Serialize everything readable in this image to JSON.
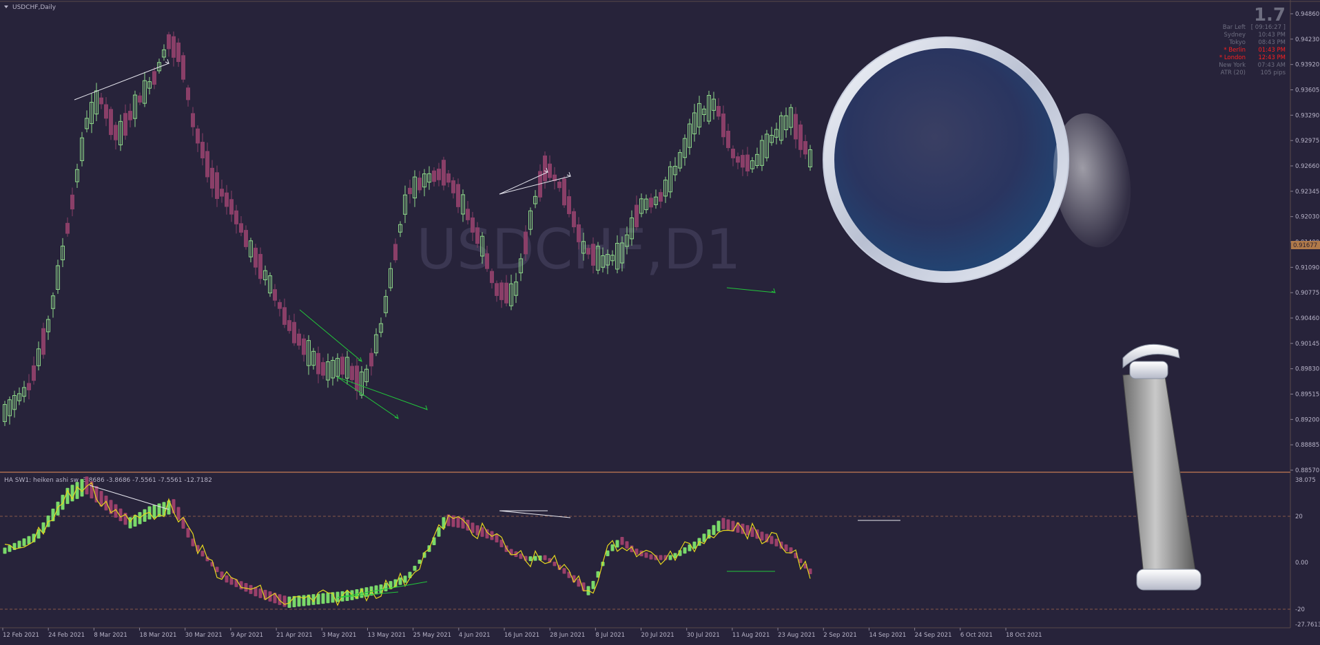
{
  "window": {
    "symbol_title": "USDCHF,Daily",
    "watermark": "USDCHF,D1"
  },
  "info_panel": {
    "big_value": "1.7",
    "rows": [
      {
        "label": "Bar Left",
        "value": "[ 09:16:27 ]",
        "highlight": false
      },
      {
        "label": "Sydney",
        "value": "10:43 PM",
        "highlight": false
      },
      {
        "label": "Tokyo",
        "value": "08:43 PM",
        "highlight": false
      },
      {
        "label": "* Berlin",
        "value": "01:43 PM",
        "highlight": true
      },
      {
        "label": "* London",
        "value": "12:43 PM",
        "highlight": true
      },
      {
        "label": "New York",
        "value": "07:43 AM",
        "highlight": false
      },
      {
        "label": "ATR (20)",
        "value": "105 pips",
        "highlight": false
      }
    ]
  },
  "price_axis": {
    "labels": [
      "0.94860",
      "0.94230",
      "0.93920",
      "0.93605",
      "0.93290",
      "0.92975",
      "0.92660",
      "0.92345",
      "0.92030",
      "0.91400",
      "0.91090",
      "0.90775",
      "0.90460",
      "0.90145",
      "0.89830",
      "0.89515",
      "0.89200",
      "0.88885",
      "0.88570"
    ],
    "current_price": "0.91677"
  },
  "indicator": {
    "title": "HA SW1: heiken ashi sw -3.8686 -3.8686 -7.5561 -7.5561 -12.7182",
    "axis_labels": [
      "38.075",
      "20",
      "0.00",
      "-20",
      "-27.7613"
    ]
  },
  "time_axis": {
    "labels": [
      "12 Feb 2021",
      "24 Feb 2021",
      "8 Mar 2021",
      "18 Mar 2021",
      "30 Mar 2021",
      "9 Apr 2021",
      "21 Apr 2021",
      "3 May 2021",
      "13 May 2021",
      "25 May 2021",
      "4 Jun 2021",
      "16 Jun 2021",
      "28 Jun 2021",
      "8 Jul 2021",
      "20 Jul 2021",
      "30 Jul 2021",
      "11 Aug 2021",
      "23 Aug 2021",
      "2 Sep 2021",
      "14 Sep 2021",
      "24 Sep 2021",
      "6 Oct 2021",
      "18 Oct 2021"
    ]
  },
  "colors": {
    "background": "#27233a",
    "bull_candle": "#8fd98a",
    "bear_candle": "#8a3f68",
    "ha_bull": "#7ad96a",
    "ha_bear": "#9a3f6a",
    "signal_line": "#e6d71e",
    "divergence_bear": "#e8e8f0",
    "divergence_bull": "#22c83a",
    "axis_text": "#b8b4c8",
    "separator": "#8a5a4a",
    "highlight_text": "#ff2020"
  },
  "icons": {
    "menu_arrow": "triangle-down-icon",
    "magnifier": "magnifying-glass-icon"
  }
}
